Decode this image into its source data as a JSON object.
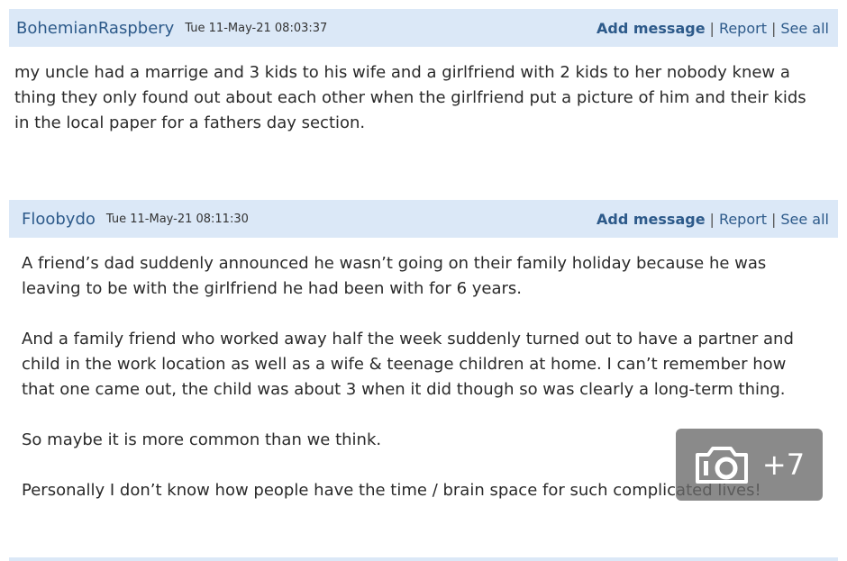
{
  "posts": [
    {
      "username": "BohemianRaspbery",
      "timestamp": "Tue 11-May-21 08:03:37",
      "actions": {
        "add": "Add message",
        "report": "Report",
        "see_all": "See all"
      },
      "lines": [
        "my uncle had a marrige and 3 kids to his wife and a girlfriend with 2 kids to her nobody knew a",
        "thing they only found out about each other when the girlfriend put a picture of him and their kids",
        "in the local paper for a fathers day section."
      ]
    },
    {
      "username": "Floobydo",
      "timestamp": "Tue 11-May-21 08:11:30",
      "actions": {
        "add": "Add message",
        "report": "Report",
        "see_all": "See all"
      },
      "paragraphs": [
        [
          "A friend’s dad suddenly announced he wasn’t going on their family holiday because he was",
          "leaving to be with the girlfriend he had been with for 6 years."
        ],
        [
          "And a family friend who worked away half the week suddenly turned out to have a partner and",
          "child in the work location as well as a wife & teenage children at home. I can’t remember how",
          "that one came out, the child was about 3 when it did though so was clearly a long-term thing."
        ],
        [
          "So maybe it is more common than we think."
        ],
        [
          "Personally I don’t know how people have the time / brain space for such complicated lives!"
        ]
      ]
    }
  ],
  "photo_overlay": {
    "icon": "camera-icon",
    "count": "+7"
  },
  "colors": {
    "header_bg": "#dbe8f7",
    "link": "#2d5a8a",
    "text": "#2a2a2a"
  }
}
